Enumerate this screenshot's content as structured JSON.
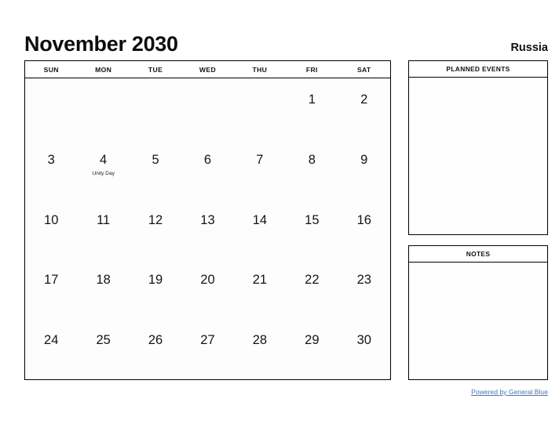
{
  "header": {
    "title": "November 2030",
    "region": "Russia"
  },
  "calendar": {
    "weekdays": [
      "SUN",
      "MON",
      "TUE",
      "WED",
      "THU",
      "FRI",
      "SAT"
    ],
    "weeks": [
      [
        {
          "day": "",
          "event": ""
        },
        {
          "day": "",
          "event": ""
        },
        {
          "day": "",
          "event": ""
        },
        {
          "day": "",
          "event": ""
        },
        {
          "day": "",
          "event": ""
        },
        {
          "day": "1",
          "event": ""
        },
        {
          "day": "2",
          "event": ""
        }
      ],
      [
        {
          "day": "3",
          "event": ""
        },
        {
          "day": "4",
          "event": "Unity Day"
        },
        {
          "day": "5",
          "event": ""
        },
        {
          "day": "6",
          "event": ""
        },
        {
          "day": "7",
          "event": ""
        },
        {
          "day": "8",
          "event": ""
        },
        {
          "day": "9",
          "event": ""
        }
      ],
      [
        {
          "day": "10",
          "event": ""
        },
        {
          "day": "11",
          "event": ""
        },
        {
          "day": "12",
          "event": ""
        },
        {
          "day": "13",
          "event": ""
        },
        {
          "day": "14",
          "event": ""
        },
        {
          "day": "15",
          "event": ""
        },
        {
          "day": "16",
          "event": ""
        }
      ],
      [
        {
          "day": "17",
          "event": ""
        },
        {
          "day": "18",
          "event": ""
        },
        {
          "day": "19",
          "event": ""
        },
        {
          "day": "20",
          "event": ""
        },
        {
          "day": "21",
          "event": ""
        },
        {
          "day": "22",
          "event": ""
        },
        {
          "day": "23",
          "event": ""
        }
      ],
      [
        {
          "day": "24",
          "event": ""
        },
        {
          "day": "25",
          "event": ""
        },
        {
          "day": "26",
          "event": ""
        },
        {
          "day": "27",
          "event": ""
        },
        {
          "day": "28",
          "event": ""
        },
        {
          "day": "29",
          "event": ""
        },
        {
          "day": "30",
          "event": ""
        }
      ]
    ]
  },
  "panels": {
    "events": {
      "title": "PLANNED EVENTS",
      "content": ""
    },
    "notes": {
      "title": "NOTES",
      "content": ""
    }
  },
  "footer": {
    "link_text": "Powered by General Blue"
  },
  "colors": {
    "link": "#3b78c3",
    "text": "#111111",
    "border": "#000000"
  }
}
